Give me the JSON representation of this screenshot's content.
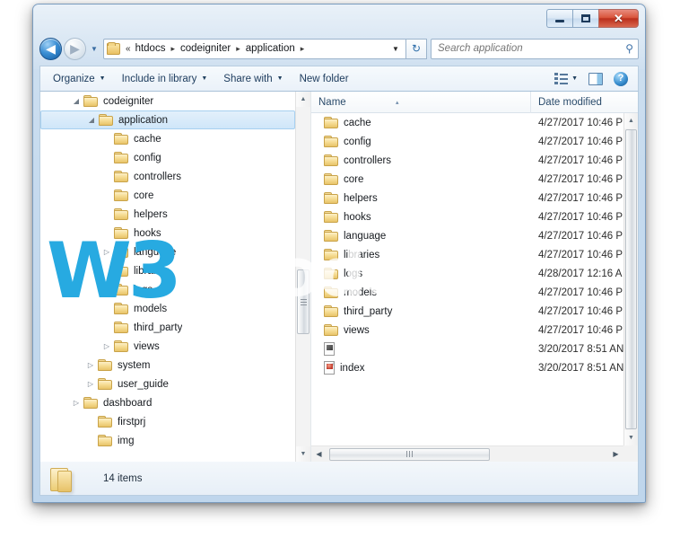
{
  "window": {
    "caption_buttons": [
      {
        "name": "minimize",
        "glyph": "—"
      },
      {
        "name": "maximize",
        "glyph": "□"
      },
      {
        "name": "close",
        "glyph": "✕"
      }
    ]
  },
  "addressbar": {
    "back_glyph": "◀",
    "forward_glyph": "▶",
    "recent_glyph": "▼",
    "overflow_glyph": "«",
    "separator_glyph": "▸",
    "dropdown_glyph": "▼",
    "refresh_glyph": "↻",
    "crumbs": [
      "htdocs",
      "codeigniter",
      "application"
    ]
  },
  "search": {
    "placeholder": "Search application",
    "value": "",
    "icon_glyph": "⚲"
  },
  "toolbar": {
    "organize_label": "Organize",
    "include_label": "Include in library",
    "share_label": "Share with",
    "newfolder_label": "New folder",
    "caret_glyph": "▼",
    "help_glyph": "?"
  },
  "tree": {
    "expander_open": "◢",
    "expander_closed": "▷",
    "items": [
      {
        "label": "codeigniter",
        "indent": 48,
        "expander": "open",
        "selected": false
      },
      {
        "label": "application",
        "indent": 64,
        "expander": "open",
        "selected": true
      },
      {
        "label": "cache",
        "indent": 82,
        "expander": "none",
        "selected": false
      },
      {
        "label": "config",
        "indent": 82,
        "expander": "none",
        "selected": false
      },
      {
        "label": "controllers",
        "indent": 82,
        "expander": "none",
        "selected": false
      },
      {
        "label": "core",
        "indent": 82,
        "expander": "none",
        "selected": false
      },
      {
        "label": "helpers",
        "indent": 82,
        "expander": "none",
        "selected": false
      },
      {
        "label": "hooks",
        "indent": 82,
        "expander": "none",
        "selected": false
      },
      {
        "label": "language",
        "indent": 82,
        "expander": "closed",
        "selected": false
      },
      {
        "label": "libraries",
        "indent": 82,
        "expander": "none",
        "selected": false
      },
      {
        "label": "logs",
        "indent": 82,
        "expander": "none",
        "selected": false
      },
      {
        "label": "models",
        "indent": 82,
        "expander": "none",
        "selected": false
      },
      {
        "label": "third_party",
        "indent": 82,
        "expander": "none",
        "selected": false
      },
      {
        "label": "views",
        "indent": 82,
        "expander": "closed",
        "selected": false
      },
      {
        "label": "system",
        "indent": 64,
        "expander": "closed",
        "selected": false
      },
      {
        "label": "user_guide",
        "indent": 64,
        "expander": "closed",
        "selected": false
      },
      {
        "label": "dashboard",
        "indent": 48,
        "expander": "closed",
        "selected": false
      },
      {
        "label": "firstprj",
        "indent": 64,
        "expander": "none",
        "selected": false
      },
      {
        "label": "img",
        "indent": 64,
        "expander": "none",
        "selected": false
      }
    ]
  },
  "filelist": {
    "columns": {
      "name": "Name",
      "date": "Date modified"
    },
    "sort_caret": "▴",
    "rows": [
      {
        "name": "cache",
        "date": "4/27/2017 10:46 P",
        "kind": "folder"
      },
      {
        "name": "config",
        "date": "4/27/2017 10:46 P",
        "kind": "folder"
      },
      {
        "name": "controllers",
        "date": "4/27/2017 10:46 P",
        "kind": "folder"
      },
      {
        "name": "core",
        "date": "4/27/2017 10:46 P",
        "kind": "folder"
      },
      {
        "name": "helpers",
        "date": "4/27/2017 10:46 P",
        "kind": "folder"
      },
      {
        "name": "hooks",
        "date": "4/27/2017 10:46 P",
        "kind": "folder"
      },
      {
        "name": "language",
        "date": "4/27/2017 10:46 P",
        "kind": "folder"
      },
      {
        "name": "libraries",
        "date": "4/27/2017 10:46 P",
        "kind": "folder"
      },
      {
        "name": "logs",
        "date": "4/28/2017 12:16 A",
        "kind": "folder"
      },
      {
        "name": "models",
        "date": "4/27/2017 10:46 P",
        "kind": "folder"
      },
      {
        "name": "third_party",
        "date": "4/27/2017 10:46 P",
        "kind": "folder"
      },
      {
        "name": "views",
        "date": "4/27/2017 10:46 P",
        "kind": "folder"
      },
      {
        "name": "",
        "date": "3/20/2017 8:51 AN",
        "kind": "file"
      },
      {
        "name": "index",
        "date": "3/20/2017 8:51 AN",
        "kind": "php"
      }
    ]
  },
  "statusbar": {
    "item_count_label": "14 items"
  },
  "watermark": {
    "primary": "W3",
    "secondary": "<code/",
    "color": "#27aae1"
  }
}
